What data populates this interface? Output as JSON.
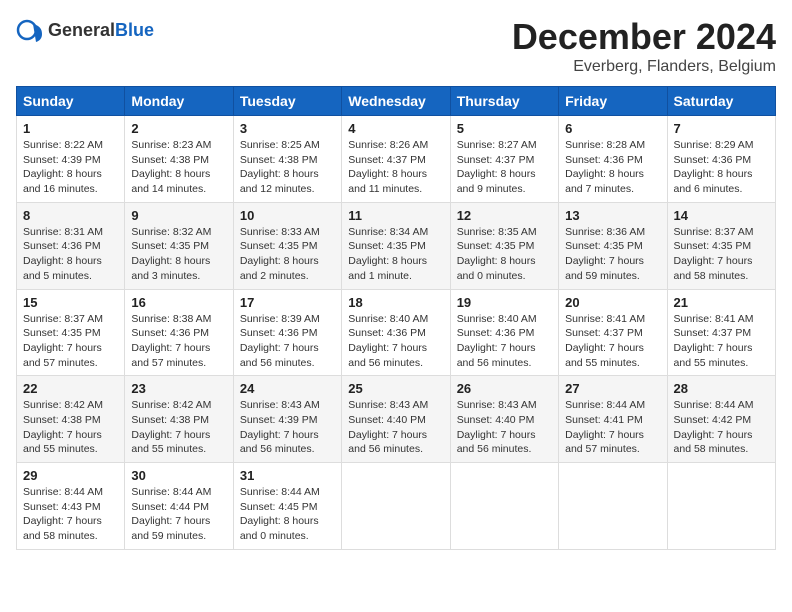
{
  "header": {
    "logo_general": "General",
    "logo_blue": "Blue",
    "month_title": "December 2024",
    "location": "Everberg, Flanders, Belgium"
  },
  "days_of_week": [
    "Sunday",
    "Monday",
    "Tuesday",
    "Wednesday",
    "Thursday",
    "Friday",
    "Saturday"
  ],
  "weeks": [
    [
      {
        "day": "1",
        "sunrise": "Sunrise: 8:22 AM",
        "sunset": "Sunset: 4:39 PM",
        "daylight": "Daylight: 8 hours and 16 minutes."
      },
      {
        "day": "2",
        "sunrise": "Sunrise: 8:23 AM",
        "sunset": "Sunset: 4:38 PM",
        "daylight": "Daylight: 8 hours and 14 minutes."
      },
      {
        "day": "3",
        "sunrise": "Sunrise: 8:25 AM",
        "sunset": "Sunset: 4:38 PM",
        "daylight": "Daylight: 8 hours and 12 minutes."
      },
      {
        "day": "4",
        "sunrise": "Sunrise: 8:26 AM",
        "sunset": "Sunset: 4:37 PM",
        "daylight": "Daylight: 8 hours and 11 minutes."
      },
      {
        "day": "5",
        "sunrise": "Sunrise: 8:27 AM",
        "sunset": "Sunset: 4:37 PM",
        "daylight": "Daylight: 8 hours and 9 minutes."
      },
      {
        "day": "6",
        "sunrise": "Sunrise: 8:28 AM",
        "sunset": "Sunset: 4:36 PM",
        "daylight": "Daylight: 8 hours and 7 minutes."
      },
      {
        "day": "7",
        "sunrise": "Sunrise: 8:29 AM",
        "sunset": "Sunset: 4:36 PM",
        "daylight": "Daylight: 8 hours and 6 minutes."
      }
    ],
    [
      {
        "day": "8",
        "sunrise": "Sunrise: 8:31 AM",
        "sunset": "Sunset: 4:36 PM",
        "daylight": "Daylight: 8 hours and 5 minutes."
      },
      {
        "day": "9",
        "sunrise": "Sunrise: 8:32 AM",
        "sunset": "Sunset: 4:35 PM",
        "daylight": "Daylight: 8 hours and 3 minutes."
      },
      {
        "day": "10",
        "sunrise": "Sunrise: 8:33 AM",
        "sunset": "Sunset: 4:35 PM",
        "daylight": "Daylight: 8 hours and 2 minutes."
      },
      {
        "day": "11",
        "sunrise": "Sunrise: 8:34 AM",
        "sunset": "Sunset: 4:35 PM",
        "daylight": "Daylight: 8 hours and 1 minute."
      },
      {
        "day": "12",
        "sunrise": "Sunrise: 8:35 AM",
        "sunset": "Sunset: 4:35 PM",
        "daylight": "Daylight: 8 hours and 0 minutes."
      },
      {
        "day": "13",
        "sunrise": "Sunrise: 8:36 AM",
        "sunset": "Sunset: 4:35 PM",
        "daylight": "Daylight: 7 hours and 59 minutes."
      },
      {
        "day": "14",
        "sunrise": "Sunrise: 8:37 AM",
        "sunset": "Sunset: 4:35 PM",
        "daylight": "Daylight: 7 hours and 58 minutes."
      }
    ],
    [
      {
        "day": "15",
        "sunrise": "Sunrise: 8:37 AM",
        "sunset": "Sunset: 4:35 PM",
        "daylight": "Daylight: 7 hours and 57 minutes."
      },
      {
        "day": "16",
        "sunrise": "Sunrise: 8:38 AM",
        "sunset": "Sunset: 4:36 PM",
        "daylight": "Daylight: 7 hours and 57 minutes."
      },
      {
        "day": "17",
        "sunrise": "Sunrise: 8:39 AM",
        "sunset": "Sunset: 4:36 PM",
        "daylight": "Daylight: 7 hours and 56 minutes."
      },
      {
        "day": "18",
        "sunrise": "Sunrise: 8:40 AM",
        "sunset": "Sunset: 4:36 PM",
        "daylight": "Daylight: 7 hours and 56 minutes."
      },
      {
        "day": "19",
        "sunrise": "Sunrise: 8:40 AM",
        "sunset": "Sunset: 4:36 PM",
        "daylight": "Daylight: 7 hours and 56 minutes."
      },
      {
        "day": "20",
        "sunrise": "Sunrise: 8:41 AM",
        "sunset": "Sunset: 4:37 PM",
        "daylight": "Daylight: 7 hours and 55 minutes."
      },
      {
        "day": "21",
        "sunrise": "Sunrise: 8:41 AM",
        "sunset": "Sunset: 4:37 PM",
        "daylight": "Daylight: 7 hours and 55 minutes."
      }
    ],
    [
      {
        "day": "22",
        "sunrise": "Sunrise: 8:42 AM",
        "sunset": "Sunset: 4:38 PM",
        "daylight": "Daylight: 7 hours and 55 minutes."
      },
      {
        "day": "23",
        "sunrise": "Sunrise: 8:42 AM",
        "sunset": "Sunset: 4:38 PM",
        "daylight": "Daylight: 7 hours and 55 minutes."
      },
      {
        "day": "24",
        "sunrise": "Sunrise: 8:43 AM",
        "sunset": "Sunset: 4:39 PM",
        "daylight": "Daylight: 7 hours and 56 minutes."
      },
      {
        "day": "25",
        "sunrise": "Sunrise: 8:43 AM",
        "sunset": "Sunset: 4:40 PM",
        "daylight": "Daylight: 7 hours and 56 minutes."
      },
      {
        "day": "26",
        "sunrise": "Sunrise: 8:43 AM",
        "sunset": "Sunset: 4:40 PM",
        "daylight": "Daylight: 7 hours and 56 minutes."
      },
      {
        "day": "27",
        "sunrise": "Sunrise: 8:44 AM",
        "sunset": "Sunset: 4:41 PM",
        "daylight": "Daylight: 7 hours and 57 minutes."
      },
      {
        "day": "28",
        "sunrise": "Sunrise: 8:44 AM",
        "sunset": "Sunset: 4:42 PM",
        "daylight": "Daylight: 7 hours and 58 minutes."
      }
    ],
    [
      {
        "day": "29",
        "sunrise": "Sunrise: 8:44 AM",
        "sunset": "Sunset: 4:43 PM",
        "daylight": "Daylight: 7 hours and 58 minutes."
      },
      {
        "day": "30",
        "sunrise": "Sunrise: 8:44 AM",
        "sunset": "Sunset: 4:44 PM",
        "daylight": "Daylight: 7 hours and 59 minutes."
      },
      {
        "day": "31",
        "sunrise": "Sunrise: 8:44 AM",
        "sunset": "Sunset: 4:45 PM",
        "daylight": "Daylight: 8 hours and 0 minutes."
      },
      {
        "day": "",
        "sunrise": "",
        "sunset": "",
        "daylight": ""
      },
      {
        "day": "",
        "sunrise": "",
        "sunset": "",
        "daylight": ""
      },
      {
        "day": "",
        "sunrise": "",
        "sunset": "",
        "daylight": ""
      },
      {
        "day": "",
        "sunrise": "",
        "sunset": "",
        "daylight": ""
      }
    ]
  ]
}
